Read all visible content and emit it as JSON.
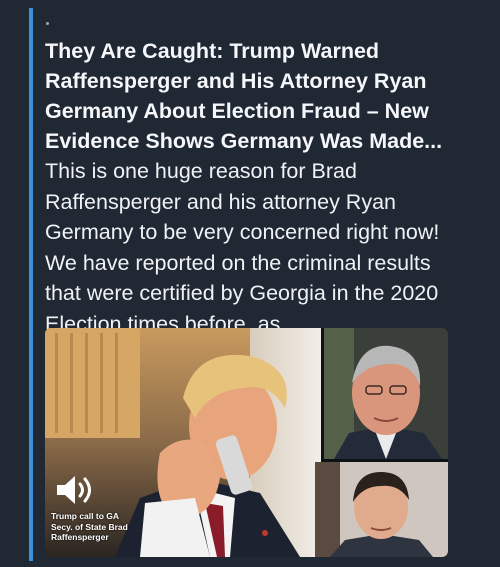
{
  "post": {
    "dot_marker": ".",
    "headline": "They Are Caught: Trump Warned Raffensperger and His Attorney Ryan Germany About Election Fraud – New Evidence Shows Germany Was Made...",
    "body": "This is one huge reason for Brad Raffensperger and his attorney Ryan Germany to be very concerned right now! We have reported on the criminal results that were certified by Georgia in the 2020 Election times before, as..."
  },
  "media": {
    "caption_lines": [
      "Trump call to GA",
      "Secy. of State Brad",
      "Raffensperger"
    ],
    "icon": "speaker-volume-icon"
  },
  "colors": {
    "background": "#1f2833",
    "quote_bar": "#3c8fd9",
    "text": "#f5f7fa"
  }
}
